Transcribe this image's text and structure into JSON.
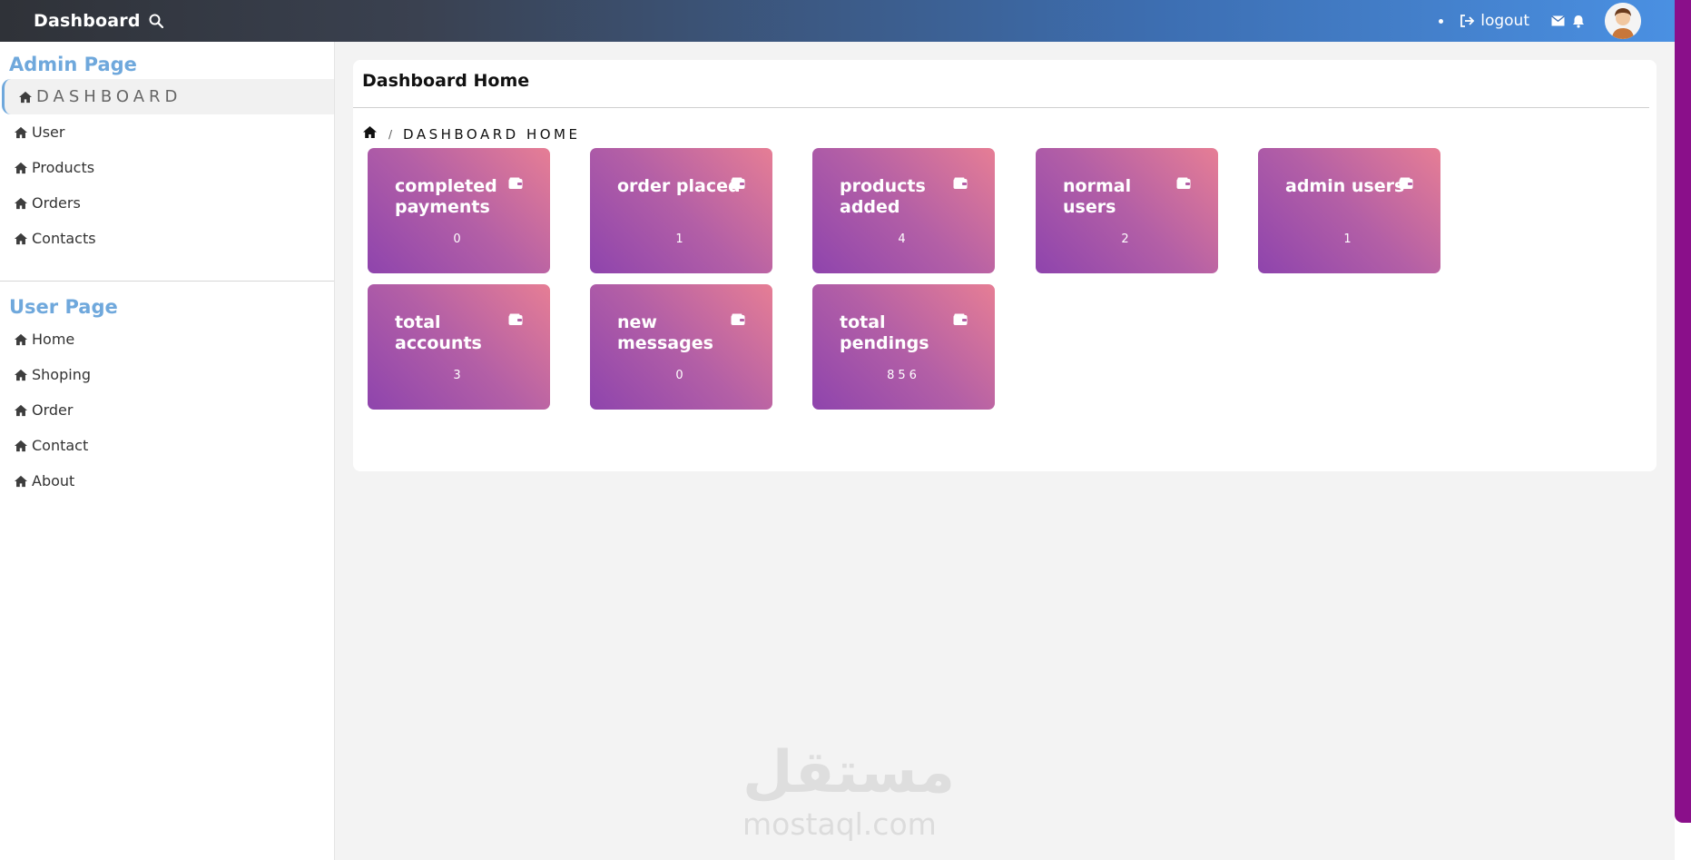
{
  "topbar": {
    "brand": "Dashboard",
    "logout_label": "logout",
    "icons": [
      "search-icon",
      "logout-icon",
      "mail-icon",
      "bell-icon",
      "avatar"
    ]
  },
  "sidebar": {
    "admin_title": "Admin Page",
    "admin_items": [
      {
        "label": "DASHBOARD",
        "icon": "home-icon",
        "active": true
      },
      {
        "label": "User",
        "icon": "home-icon"
      },
      {
        "label": "Products",
        "icon": "home-icon"
      },
      {
        "label": "Orders",
        "icon": "home-icon"
      },
      {
        "label": "Contacts",
        "icon": "home-icon"
      }
    ],
    "user_title": "User Page",
    "user_items": [
      {
        "label": "Home",
        "icon": "home-icon"
      },
      {
        "label": "Shoping",
        "icon": "home-icon"
      },
      {
        "label": "Order",
        "icon": "home-icon"
      },
      {
        "label": "Contact",
        "icon": "home-icon"
      },
      {
        "label": "About",
        "icon": "home-icon"
      }
    ]
  },
  "main": {
    "title": "Dashboard Home",
    "breadcrumb": {
      "separator": "/",
      "current": "DASHBOARD HOME"
    },
    "cards": [
      {
        "title": "completed payments",
        "value": "0",
        "icon": "wallet-icon"
      },
      {
        "title": "order placed",
        "value": "1",
        "icon": "wallet-icon"
      },
      {
        "title": "products added",
        "value": "4",
        "icon": "wallet-icon"
      },
      {
        "title": "normal users",
        "value": "2",
        "icon": "wallet-icon"
      },
      {
        "title": "admin users",
        "value": "1",
        "icon": "wallet-icon"
      },
      {
        "title": "total accounts",
        "value": "3",
        "icon": "wallet-icon"
      },
      {
        "title": "new messages",
        "value": "0",
        "icon": "wallet-icon"
      },
      {
        "title": "total pendings",
        "value": "856",
        "icon": "wallet-icon"
      }
    ]
  },
  "watermark": {
    "arabic": "مستقل",
    "latin": "mostaql.com"
  },
  "colors": {
    "accent": "#6fa8dc",
    "card_start": "#8e44ad",
    "card_end": "#e67e95",
    "scrollbar": "#8a0f8a"
  }
}
